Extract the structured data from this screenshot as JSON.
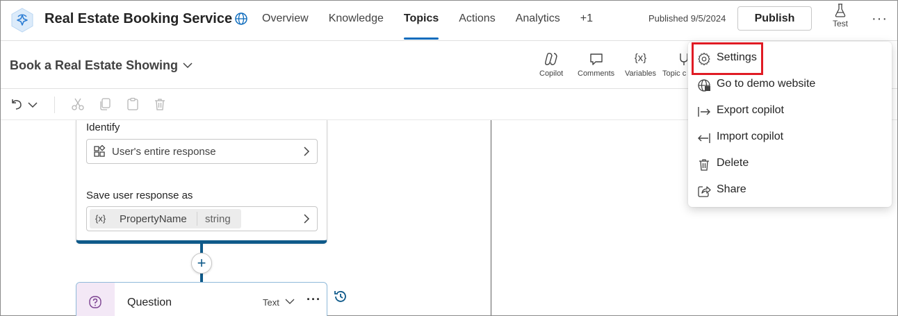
{
  "header": {
    "app_title": "Real Estate Booking Service",
    "nav": [
      {
        "label": "Overview",
        "active": false
      },
      {
        "label": "Knowledge",
        "active": false
      },
      {
        "label": "Topics",
        "active": true
      },
      {
        "label": "Actions",
        "active": false
      },
      {
        "label": "Analytics",
        "active": false
      },
      {
        "label": "+1",
        "active": false
      }
    ],
    "published_text": "Published 9/5/2024",
    "publish_label": "Publish",
    "test_label": "Test",
    "more_icon": "more-horizontal-icon"
  },
  "subheader": {
    "topic_title": "Book a Real Estate Showing",
    "tools": [
      {
        "label": "Copilot",
        "icon": "copilot-icon"
      },
      {
        "label": "Comments",
        "icon": "comment-icon"
      },
      {
        "label": "Variables",
        "icon": "variable-icon"
      },
      {
        "label": "Topic c",
        "icon": "topic-checker-icon"
      }
    ]
  },
  "toolbar": {
    "icons": [
      "undo-icon",
      "chevron-down-icon",
      "cut-icon",
      "copy-icon",
      "paste-icon",
      "delete-icon"
    ]
  },
  "canvas": {
    "identify_label": "Identify",
    "identify_value": "User's entire response",
    "save_label": "Save user response as",
    "var_symbol": "{x}",
    "var_name": "PropertyName",
    "var_type": "string",
    "add_symbol": "+",
    "question_title": "Question",
    "question_type": "Text"
  },
  "menu": {
    "items": [
      {
        "label": "Settings",
        "icon": "gear-icon"
      },
      {
        "label": "Go to demo website",
        "icon": "globe-icon"
      },
      {
        "label": "Export copilot",
        "icon": "export-icon"
      },
      {
        "label": "Import copilot",
        "icon": "import-icon"
      },
      {
        "label": "Delete",
        "icon": "trash-icon"
      },
      {
        "label": "Share",
        "icon": "share-icon"
      }
    ],
    "highlighted": "Settings"
  },
  "colors": {
    "accent": "#0f6cbd",
    "connector": "#0f5a8a",
    "highlight_box": "#e01b24",
    "question_icon_bg": "#f3e8f6"
  }
}
